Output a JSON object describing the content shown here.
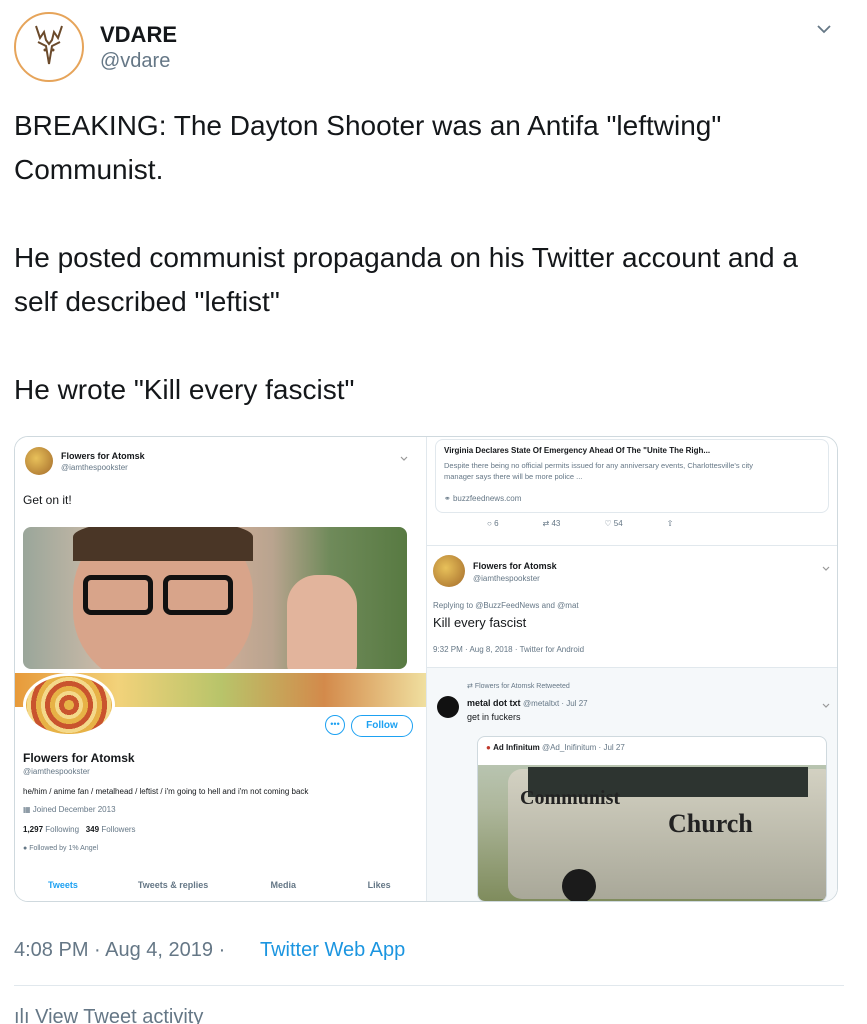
{
  "account": {
    "name": "VDARE",
    "handle": "@vdare"
  },
  "tweet": {
    "text": "BREAKING: The Dayton Shooter was an Antifa \"leftwing\" Communist.\n\nHe posted communist propaganda on his Twitter account and a self described \"leftist\"\n\nHe wrote \"Kill every fascist\""
  },
  "screenshot_left": {
    "tweet": {
      "name": "Flowers for Atomsk",
      "handle": "@iamthespookster",
      "text": "Get on it!"
    },
    "profile": {
      "follow_label": "Follow",
      "name": "Flowers for Atomsk",
      "handle": "@iamthespookster",
      "bio": "he/him / anime fan / metalhead / leftist / i'm going to hell and i'm not coming back",
      "joined": "Joined December 2013",
      "following_count": "1,297",
      "following_label": "Following",
      "followers_count": "349",
      "followers_label": "Followers",
      "followed_by": "Followed by 1% Angel",
      "tabs": [
        "Tweets",
        "Tweets & replies",
        "Media",
        "Likes"
      ]
    }
  },
  "screenshot_right": {
    "link_card": {
      "title": "Virginia Declares State Of Emergency Ahead Of The \"Unite The Righ...",
      "desc": "Despite there being no official permits issued for any anniversary events, Charlottesville's city manager says there will be more police ...",
      "domain": "buzzfeednews.com"
    },
    "actions": {
      "replies": "6",
      "retweets": "43",
      "likes": "54"
    },
    "reply": {
      "name": "Flowers for Atomsk",
      "handle": "@iamthespookster",
      "replying_to": "Replying to @BuzzFeedNews and @mat",
      "text": "Kill every fascist",
      "meta": "9:32 PM · Aug 8, 2018 · Twitter for Android"
    },
    "retweet": {
      "label": "Flowers for Atomsk Retweeted",
      "name": "metal dot txt",
      "handle": "@metaltxt · Jul 27",
      "text": "get in fuckers",
      "quote_name": "Ad Infinitum",
      "quote_handle": "@Ad_Inifinitum · Jul 27",
      "van_text_1": "Communist",
      "van_text_2": "Church"
    }
  },
  "footer": {
    "time": "4:08 PM · Aug 4, 2019 ·",
    "app": "Twitter Web App",
    "activity": "View Tweet activity"
  },
  "colors": {
    "link": "#1b95e0",
    "muted": "#657786",
    "avatar_ring": "#e6a45a"
  }
}
